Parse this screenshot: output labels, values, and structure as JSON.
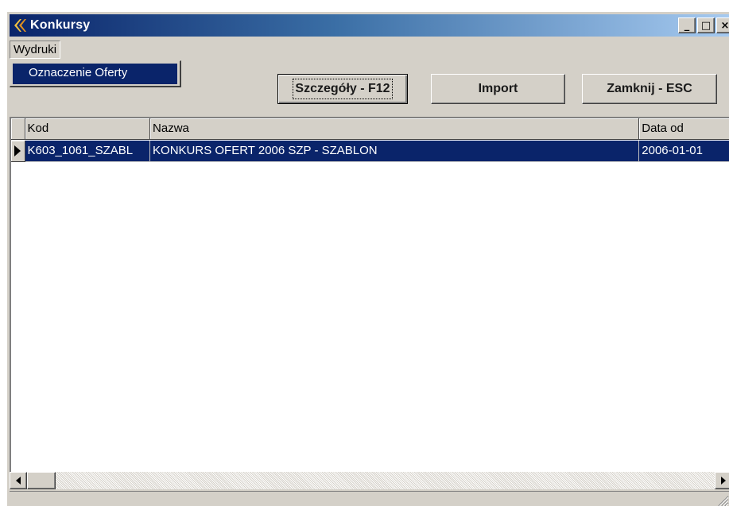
{
  "window": {
    "title": "Konkursy",
    "caption_minimize": "_",
    "caption_maximize": "□",
    "caption_close": "×"
  },
  "menu": {
    "items": [
      {
        "label": "Wydruki"
      }
    ],
    "open_dropdown": {
      "items": [
        {
          "label": "Oznaczenie Oferty",
          "highlighted": true
        }
      ]
    }
  },
  "toolbar": {
    "details_label": "Szczegóły - F12",
    "import_label": "Import",
    "close_label": "Zamknij - ESC"
  },
  "grid": {
    "columns": [
      "Kod",
      "Nazwa",
      "Data od"
    ],
    "rows": [
      {
        "kod": "K603_1061_SZABL",
        "nazwa": "KONKURS OFERT 2006 SZP - SZABLON",
        "data_od": "2006-01-01",
        "selected": true
      }
    ]
  },
  "colors": {
    "selection": "#0a246a",
    "face": "#d4d0c8",
    "title_gradient_start": "#0a246a",
    "title_gradient_end": "#a6caf0"
  }
}
